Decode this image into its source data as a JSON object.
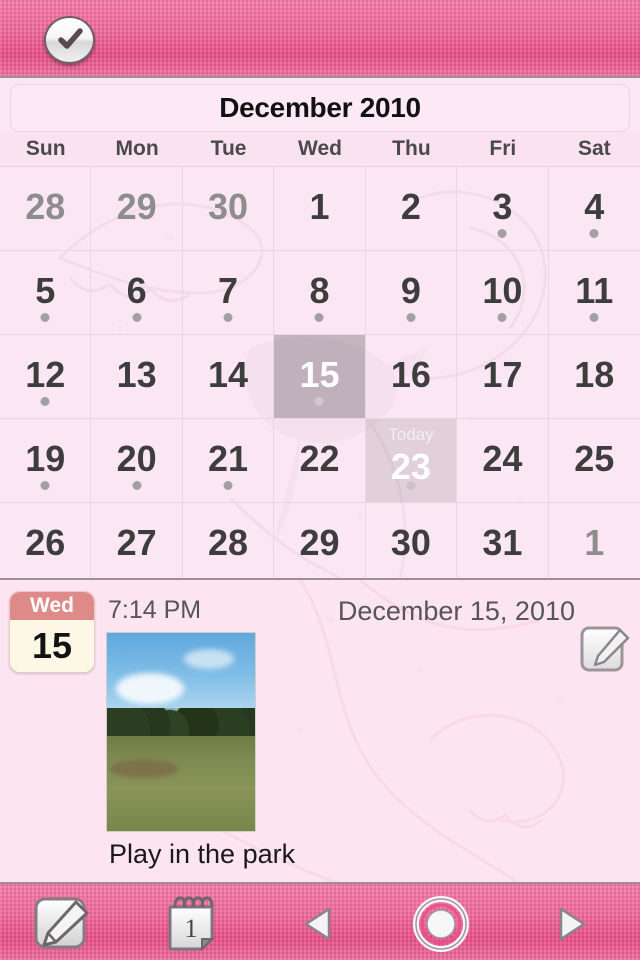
{
  "topbar": {
    "confirm_label": "check-mark",
    "accent_pink": "#ef5c93"
  },
  "calendar": {
    "month_title": "December 2010",
    "weekday_headers": [
      "Sun",
      "Mon",
      "Tue",
      "Wed",
      "Thu",
      "Fri",
      "Sat"
    ],
    "today_label": "Today",
    "selected_day": 15,
    "today_day": 23,
    "days": [
      {
        "n": "28",
        "other": true,
        "dot": false
      },
      {
        "n": "29",
        "other": true,
        "dot": false
      },
      {
        "n": "30",
        "other": true,
        "dot": false
      },
      {
        "n": "1",
        "other": false,
        "dot": false
      },
      {
        "n": "2",
        "other": false,
        "dot": false
      },
      {
        "n": "3",
        "other": false,
        "dot": true
      },
      {
        "n": "4",
        "other": false,
        "dot": true
      },
      {
        "n": "5",
        "other": false,
        "dot": true
      },
      {
        "n": "6",
        "other": false,
        "dot": true
      },
      {
        "n": "7",
        "other": false,
        "dot": true
      },
      {
        "n": "8",
        "other": false,
        "dot": true
      },
      {
        "n": "9",
        "other": false,
        "dot": true
      },
      {
        "n": "10",
        "other": false,
        "dot": true
      },
      {
        "n": "11",
        "other": false,
        "dot": true
      },
      {
        "n": "12",
        "other": false,
        "dot": true
      },
      {
        "n": "13",
        "other": false,
        "dot": false
      },
      {
        "n": "14",
        "other": false,
        "dot": false
      },
      {
        "n": "15",
        "other": false,
        "dot": true,
        "selected": true
      },
      {
        "n": "16",
        "other": false,
        "dot": false
      },
      {
        "n": "17",
        "other": false,
        "dot": false
      },
      {
        "n": "18",
        "other": false,
        "dot": false
      },
      {
        "n": "19",
        "other": false,
        "dot": true
      },
      {
        "n": "20",
        "other": false,
        "dot": true
      },
      {
        "n": "21",
        "other": false,
        "dot": true
      },
      {
        "n": "22",
        "other": false,
        "dot": false
      },
      {
        "n": "23",
        "other": false,
        "dot": true,
        "today": true
      },
      {
        "n": "24",
        "other": false,
        "dot": false
      },
      {
        "n": "25",
        "other": false,
        "dot": false
      },
      {
        "n": "26",
        "other": false,
        "dot": false
      },
      {
        "n": "27",
        "other": false,
        "dot": false
      },
      {
        "n": "28",
        "other": false,
        "dot": false
      },
      {
        "n": "29",
        "other": false,
        "dot": false
      },
      {
        "n": "30",
        "other": false,
        "dot": false
      },
      {
        "n": "31",
        "other": false,
        "dot": false
      },
      {
        "n": "1",
        "other": true,
        "dot": false
      }
    ]
  },
  "detail": {
    "badge_weekday": "Wed",
    "badge_day": "15",
    "event_time": "7:14 PM",
    "event_date": "December 15, 2010",
    "caption": "Play in the park",
    "photo_alt": "park-photo",
    "edit_icon": "note-pencil-icon"
  },
  "toolbar": {
    "compose_icon": "compose-pencil-icon",
    "journal_icon": "notepad-calendar-icon",
    "journal_count": "1",
    "prev_icon": "triangle-left-icon",
    "today_icon": "target-circle-icon",
    "next_icon": "triangle-right-icon"
  }
}
